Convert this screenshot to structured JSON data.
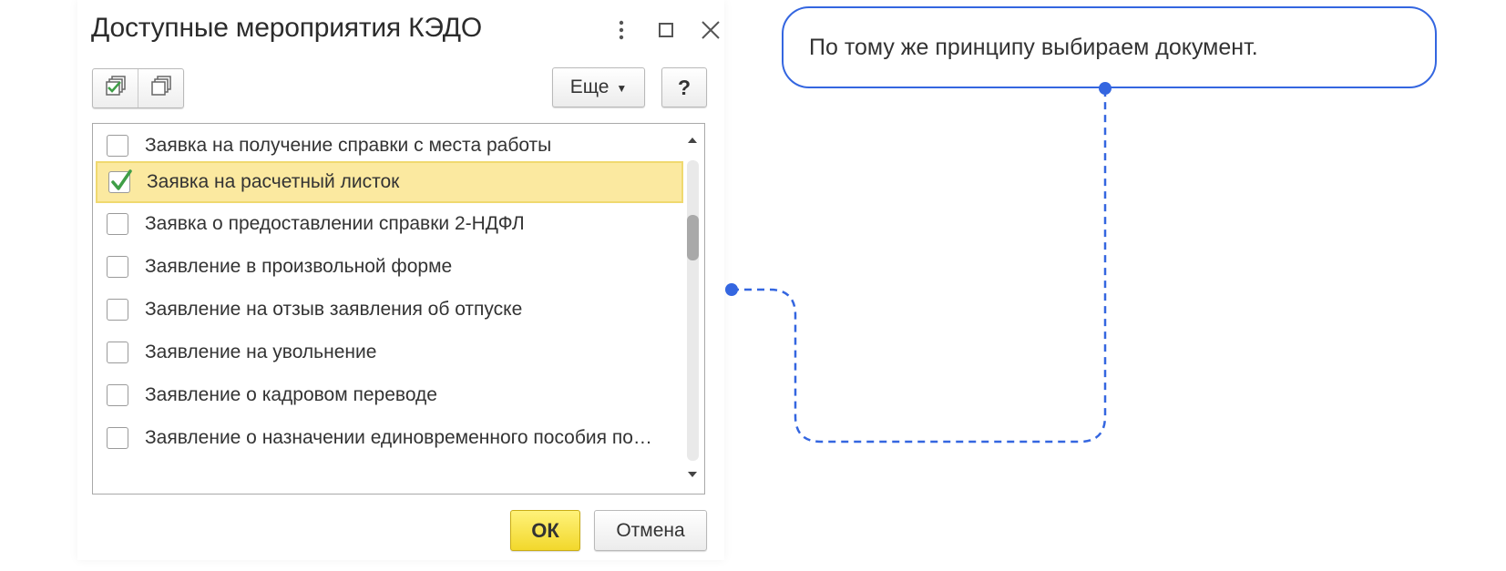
{
  "dialog": {
    "title": "Доступные мероприятия КЭДО",
    "more_label": "Еще",
    "help_label": "?",
    "ok_label": "ОК",
    "cancel_label": "Отмена"
  },
  "list": {
    "items": [
      {
        "label": "Заявка на получение справки с места работы",
        "checked": false
      },
      {
        "label": "Заявка на расчетный листок",
        "checked": true
      },
      {
        "label": "Заявка о предоставлении справки 2-НДФЛ",
        "checked": false
      },
      {
        "label": "Заявление в произвольной форме",
        "checked": false
      },
      {
        "label": "Заявление на отзыв заявления об отпуске",
        "checked": false
      },
      {
        "label": "Заявление на увольнение",
        "checked": false
      },
      {
        "label": "Заявление о кадровом переводе",
        "checked": false
      },
      {
        "label": "Заявление о назначении единовременного пособия по…",
        "checked": false
      }
    ]
  },
  "callout": {
    "text": "По тому же принципу выбираем документ."
  },
  "colors": {
    "accent": "#3466e0",
    "selected_row": "#fbe9a0",
    "ok_button": "#f5dd3a",
    "check": "#3f9e47"
  },
  "icons": {
    "more": "more-vertical-icon",
    "maximize": "maximize-icon",
    "close": "close-icon",
    "check_all": "check-all-icon",
    "uncheck_all": "uncheck-all-icon",
    "dropdown": "caret-down-icon",
    "checkmark": "checkmark-icon"
  }
}
